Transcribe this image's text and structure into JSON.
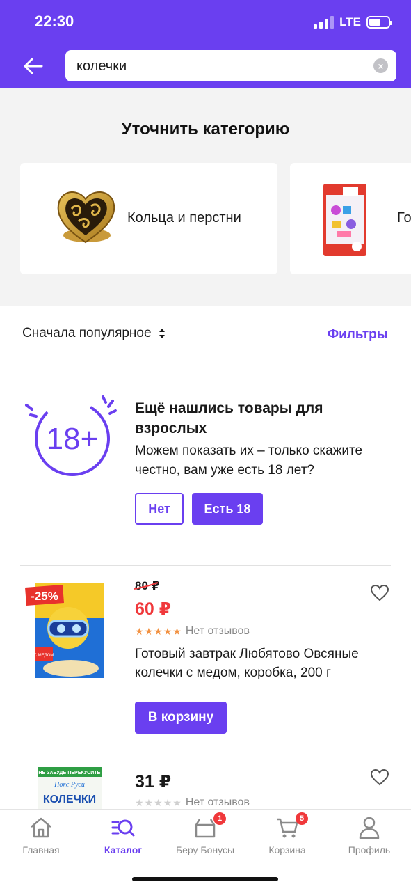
{
  "status_bar": {
    "time": "22:30",
    "network": "LTE"
  },
  "search": {
    "value": "колечки",
    "back_icon": "arrow-left-icon",
    "clear_icon": "clear-icon"
  },
  "categories": {
    "title": "Уточнить категорию",
    "items": [
      {
        "label": "Кольца и перстни",
        "icon": "ring-image"
      },
      {
        "label": "Го",
        "icon": "toy-box-image"
      }
    ]
  },
  "sort": {
    "label": "Сначала популярное",
    "filters_label": "Фильтры"
  },
  "adult_notice": {
    "title": "Ещё нашлись товары для взрослых",
    "text": "Можем показать их – только скажите честно, вам уже есть 18 лет?",
    "badge_text": "18+",
    "no_label": "Нет",
    "yes_label": "Есть 18"
  },
  "products": [
    {
      "old_price": "80 ₽",
      "price": "60 ₽",
      "discount": "-25%",
      "reviews": "Нет отзывов",
      "rating": 5,
      "title": "Готовый завтрак Любятово Овсяные колечки с медом, коробка, 200 г",
      "cart_label": "В корзину",
      "package_text": "С МЕДОМ"
    },
    {
      "price": "31 ₽",
      "reviews": "Нет отзывов",
      "rating": 0,
      "package_banner": "НЕ ЗАБУДЬ ПЕРЕКУСИТЬ",
      "package_brand": "Пояс Руси",
      "package_name": "КОЛЕЧКИ"
    }
  ],
  "bottom_nav": [
    {
      "label": "Главная",
      "icon": "home-icon",
      "active": false
    },
    {
      "label": "Каталог",
      "icon": "catalog-search-icon",
      "active": true
    },
    {
      "label": "Беру Бонусы",
      "icon": "bonus-box-icon",
      "badge": "1"
    },
    {
      "label": "Корзина",
      "icon": "cart-icon",
      "badge": "5"
    },
    {
      "label": "Профиль",
      "icon": "profile-icon",
      "active": false
    }
  ],
  "colors": {
    "accent": "#6a3ff0",
    "sale": "#f0383b",
    "star": "#f29141"
  }
}
